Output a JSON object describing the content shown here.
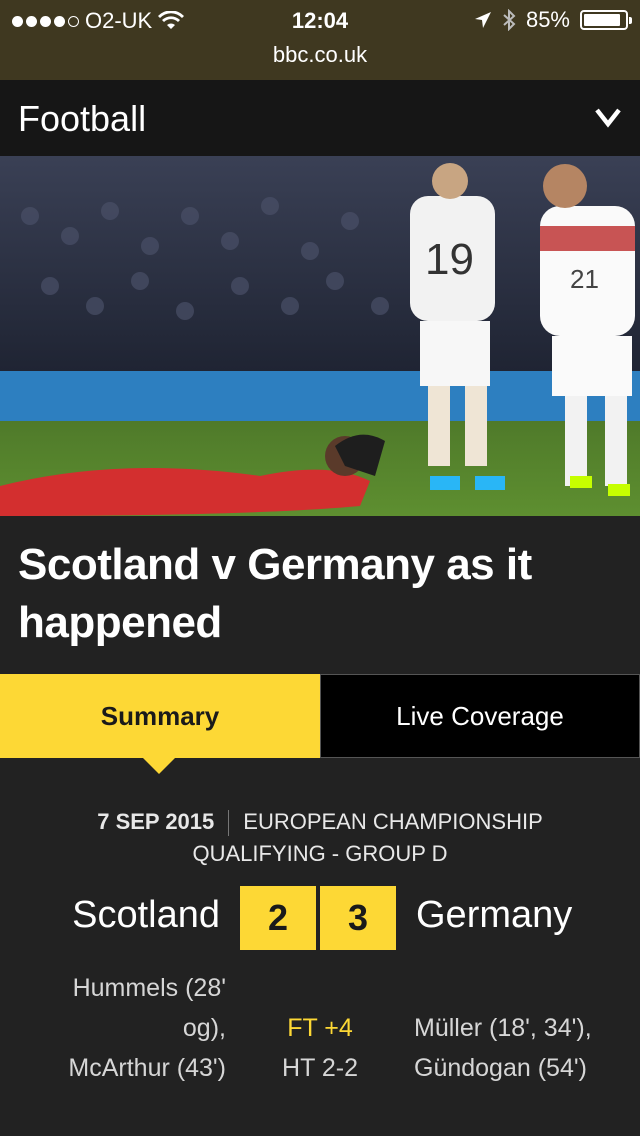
{
  "status_bar": {
    "carrier": "O2-UK",
    "time": "12:04",
    "battery": "85%",
    "battery_level": 0.85,
    "icons": [
      "wifi-icon",
      "location-icon",
      "bluetooth-icon",
      "battery-icon"
    ]
  },
  "browser": {
    "url": "bbc.co.uk"
  },
  "section": {
    "title": "Football"
  },
  "article": {
    "headline": "Scotland v Germany as it happened"
  },
  "tabs": [
    {
      "label": "Summary",
      "active": true
    },
    {
      "label": "Live Coverage",
      "active": false
    }
  ],
  "match": {
    "date": "7 SEP 2015",
    "competition": "EUROPEAN CHAMPIONSHIP QUALIFYING - GROUP D",
    "home_team": "Scotland",
    "away_team": "Germany",
    "home_score": "2",
    "away_score": "3",
    "full_time": "FT +4",
    "half_time": "HT 2-2",
    "home_scorers": [
      "Hummels (28'",
      "og),",
      "McArthur (43')"
    ],
    "away_scorers": [
      "Müller (18', 34'),",
      "Gündogan (54')"
    ]
  },
  "colors": {
    "accent": "#fdd835",
    "status_bar": "#3f3820",
    "section_bar": "#161616",
    "background": "#222222"
  }
}
